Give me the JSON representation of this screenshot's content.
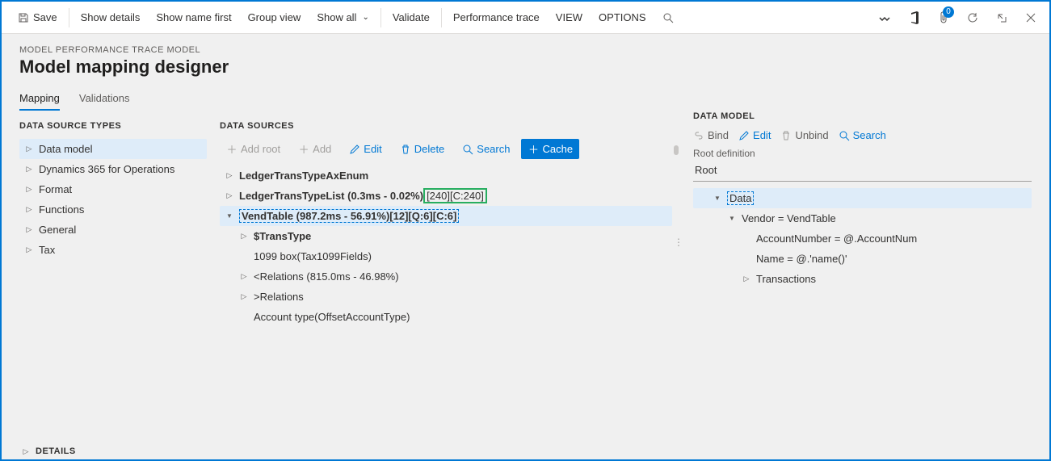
{
  "top": {
    "save": "Save",
    "showDetails": "Show details",
    "showNameFirst": "Show name first",
    "groupView": "Group view",
    "showAll": "Show all",
    "validate": "Validate",
    "perfTrace": "Performance trace",
    "view": "VIEW",
    "options": "OPTIONS",
    "badgeCount": "0"
  },
  "breadcrumb": "MODEL PERFORMANCE TRACE MODEL",
  "pageTitle": "Model mapping designer",
  "tabs": {
    "mapping": "Mapping",
    "validations": "Validations"
  },
  "left": {
    "head": "DATA SOURCE TYPES",
    "items": [
      "Data model",
      "Dynamics 365 for Operations",
      "Format",
      "Functions",
      "General",
      "Tax"
    ]
  },
  "mid": {
    "head": "DATA SOURCES",
    "toolbar": {
      "addRoot": "Add root",
      "add": "Add",
      "edit": "Edit",
      "delete": "Delete",
      "search": "Search",
      "cache": "Cache"
    },
    "items": {
      "ledgerAx": "LedgerTransTypeAxEnum",
      "ledgerListBase": "LedgerTransTypeList (0.3ms - 0.02%)",
      "ledgerListGreen": "[240][C:240]",
      "vendTable": "VendTable (987.2ms - 56.91%)[12][Q:6][C:6]",
      "transType": "$TransType",
      "taxBox": "1099 box(Tax1099Fields)",
      "relLess": "<Relations (815.0ms - 46.98%)",
      "relMore": ">Relations",
      "accountType": "Account type(OffsetAccountType)"
    }
  },
  "right": {
    "head": "DATA MODEL",
    "toolbar": {
      "bind": "Bind",
      "edit": "Edit",
      "unbind": "Unbind",
      "search": "Search"
    },
    "rootLabel": "Root definition",
    "rootVal": "Root",
    "items": {
      "data": "Data",
      "vendor": "Vendor = VendTable",
      "account": "AccountNumber = @.AccountNum",
      "name": "Name = @.'name()'",
      "trans": "Transactions"
    }
  },
  "details": "DETAILS"
}
